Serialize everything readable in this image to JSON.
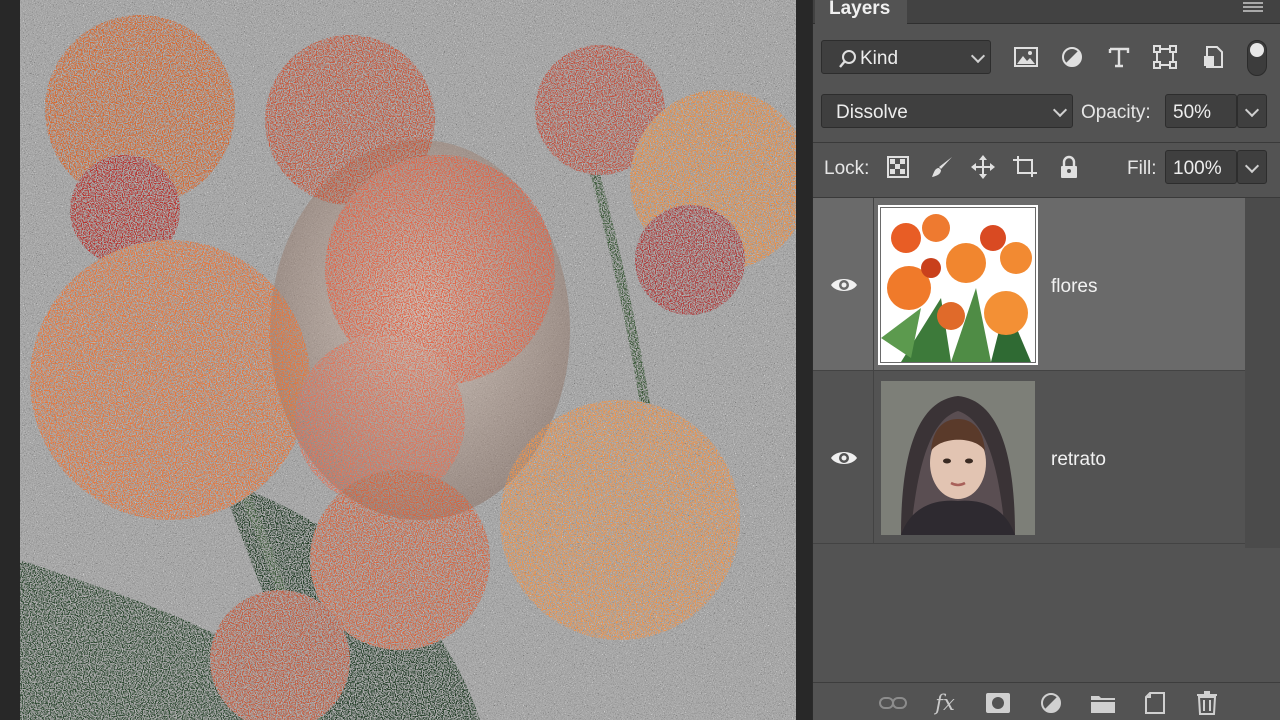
{
  "panel": {
    "tab_label": "Layers",
    "filter": {
      "selected": "Kind"
    },
    "blend_mode": {
      "selected": "Dissolve"
    },
    "opacity": {
      "label": "Opacity:",
      "value": "50%"
    },
    "lock": {
      "label": "Lock:"
    },
    "fill": {
      "label": "Fill:",
      "value": "100%"
    },
    "layers": [
      {
        "name": "flores",
        "visible": true,
        "selected": true
      },
      {
        "name": "retrato",
        "visible": true,
        "selected": false
      }
    ]
  },
  "filter_icons": [
    "image-filter-icon",
    "adjustment-filter-icon",
    "type-filter-icon",
    "shape-filter-icon",
    "smart-object-filter-icon"
  ],
  "lock_icons": [
    "lock-transparent-pixels-icon",
    "lock-image-pixels-icon",
    "lock-position-icon",
    "lock-artboard-icon",
    "lock-all-icon"
  ],
  "bottom_icons": [
    "link-layers-icon",
    "fx-icon",
    "add-mask-icon",
    "new-adjustment-layer-icon",
    "new-group-icon",
    "new-layer-icon",
    "delete-layer-icon"
  ],
  "colors": {
    "panel_bg": "#535353",
    "selected_layer": "#6a6a6a",
    "field_bg": "#3f3f3f",
    "rose_orange": "#e8763a",
    "rose_red": "#b8332e"
  }
}
